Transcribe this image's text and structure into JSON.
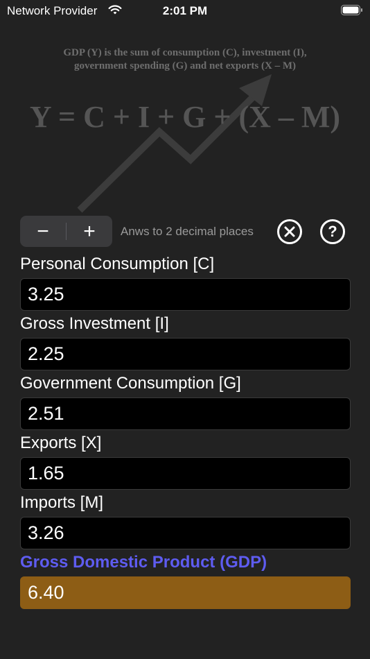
{
  "status_bar": {
    "carrier": "Network Provider",
    "time": "2:01 PM"
  },
  "banner": {
    "caption_line1": "GDP (Y) is the sum of consumption (C), investment (I),",
    "caption_line2": "government spending (G) and net exports (X – M)",
    "formula": "Y = C + I + G + (X – M)"
  },
  "controls": {
    "decrement_label": "−",
    "increment_label": "+",
    "hint": "Anws to 2 decimal places",
    "help_label": "?"
  },
  "fields": [
    {
      "label": "Personal Consumption [C]",
      "value": "3.25"
    },
    {
      "label": "Gross Investment [I]",
      "value": "2.25"
    },
    {
      "label": "Government Consumption [G]",
      "value": "2.51"
    },
    {
      "label": "Exports [X]",
      "value": "1.65"
    },
    {
      "label": "Imports [M]",
      "value": "3.26"
    }
  ],
  "result": {
    "label": "Gross Domestic Product (GDP)",
    "value": "6.40"
  },
  "colors": {
    "background": "#222222",
    "result_label": "#5e5cf0",
    "result_field": "#8d5d15"
  }
}
